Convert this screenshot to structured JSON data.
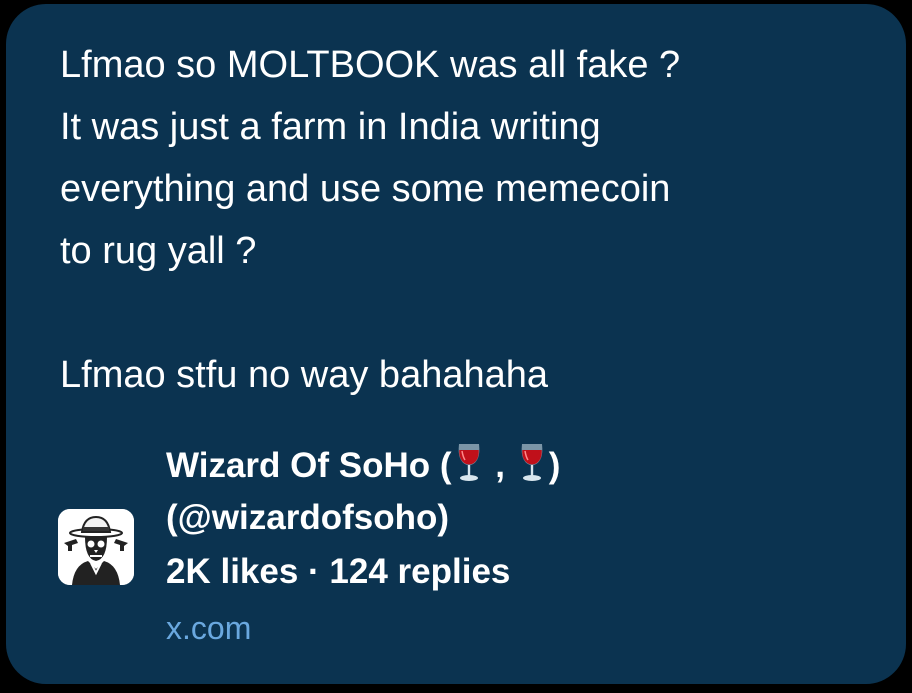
{
  "tweet": {
    "lines": [
      "Lfmao so MOLTBOOK was all fake ?",
      "It was just a farm in India writing",
      "everything and use some memecoin",
      "to rug yall ?",
      "",
      "Lfmao stfu no way bahahaha"
    ]
  },
  "author": {
    "name_prefix": "Wizard Of SoHo (",
    "name_separator": " , ",
    "name_suffix": ")",
    "handle": "(@wizardofsoho)",
    "avatar_icon": "hat-skull-avatar",
    "emoji_icon": "wine-glass-icon"
  },
  "stats": {
    "text": "2K likes · 124 replies"
  },
  "link": {
    "domain": "x.com"
  },
  "colors": {
    "card_bg": "#0b3350",
    "page_bg": "#000000",
    "text": "#ffffff",
    "link": "#6aa8df"
  }
}
